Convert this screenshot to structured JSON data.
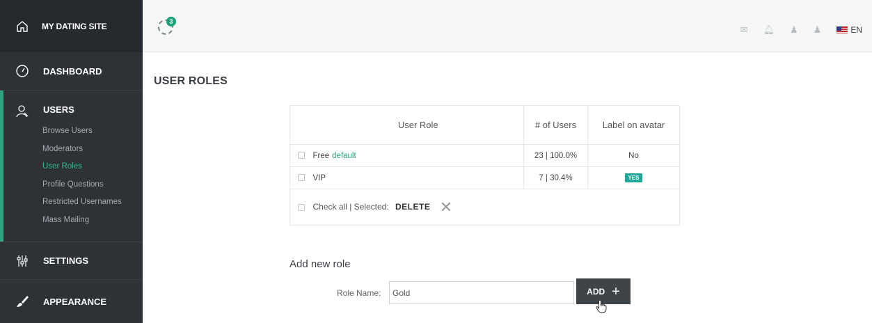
{
  "sidebar": {
    "brand": "MY DATING SITE",
    "dashboard": "DASHBOARD",
    "users": "USERS",
    "sub_items": [
      "Browse Users",
      "Moderators",
      "User Roles",
      "Profile Questions",
      "Restricted Usernames",
      "Mass Mailing"
    ],
    "active_sub_item": "User Roles",
    "settings": "SETTINGS",
    "appearance": "APPEARANCE",
    "icons": [
      "home-icon",
      "dashboard-gauge-icon",
      "users-icon",
      "settings-sliders-icon",
      "appearance-brush-icon"
    ]
  },
  "topbar": {
    "sync_badge": "3",
    "language": "EN",
    "icons": [
      "mail-icon",
      "bell-icon",
      "user-icon",
      "user-icon",
      "us-flag-icon"
    ]
  },
  "page": {
    "title": "USER ROLES"
  },
  "table": {
    "headers": {
      "role": "User Role",
      "users": "# of Users",
      "label": "Label on avatar"
    },
    "rows": [
      {
        "role": "Free",
        "tag": "default",
        "users": "23 | 100.0%",
        "label": "No"
      },
      {
        "role": "VIP",
        "tag": "",
        "users": "7 | 30.4%",
        "label": "YES"
      }
    ],
    "footer": {
      "check_all": "Check all | Selected:",
      "delete": "DELETE",
      "close": "✕"
    }
  },
  "add_role": {
    "title": "Add new role",
    "label": "Role Name:",
    "value": "Gold",
    "button": "ADD",
    "button_icon": "+"
  },
  "colors": {
    "sidebar_bg": "#2b2f33",
    "accent_green": "#2fa47e",
    "badge_teal": "#1fa898",
    "button_dark": "#3f4449"
  }
}
